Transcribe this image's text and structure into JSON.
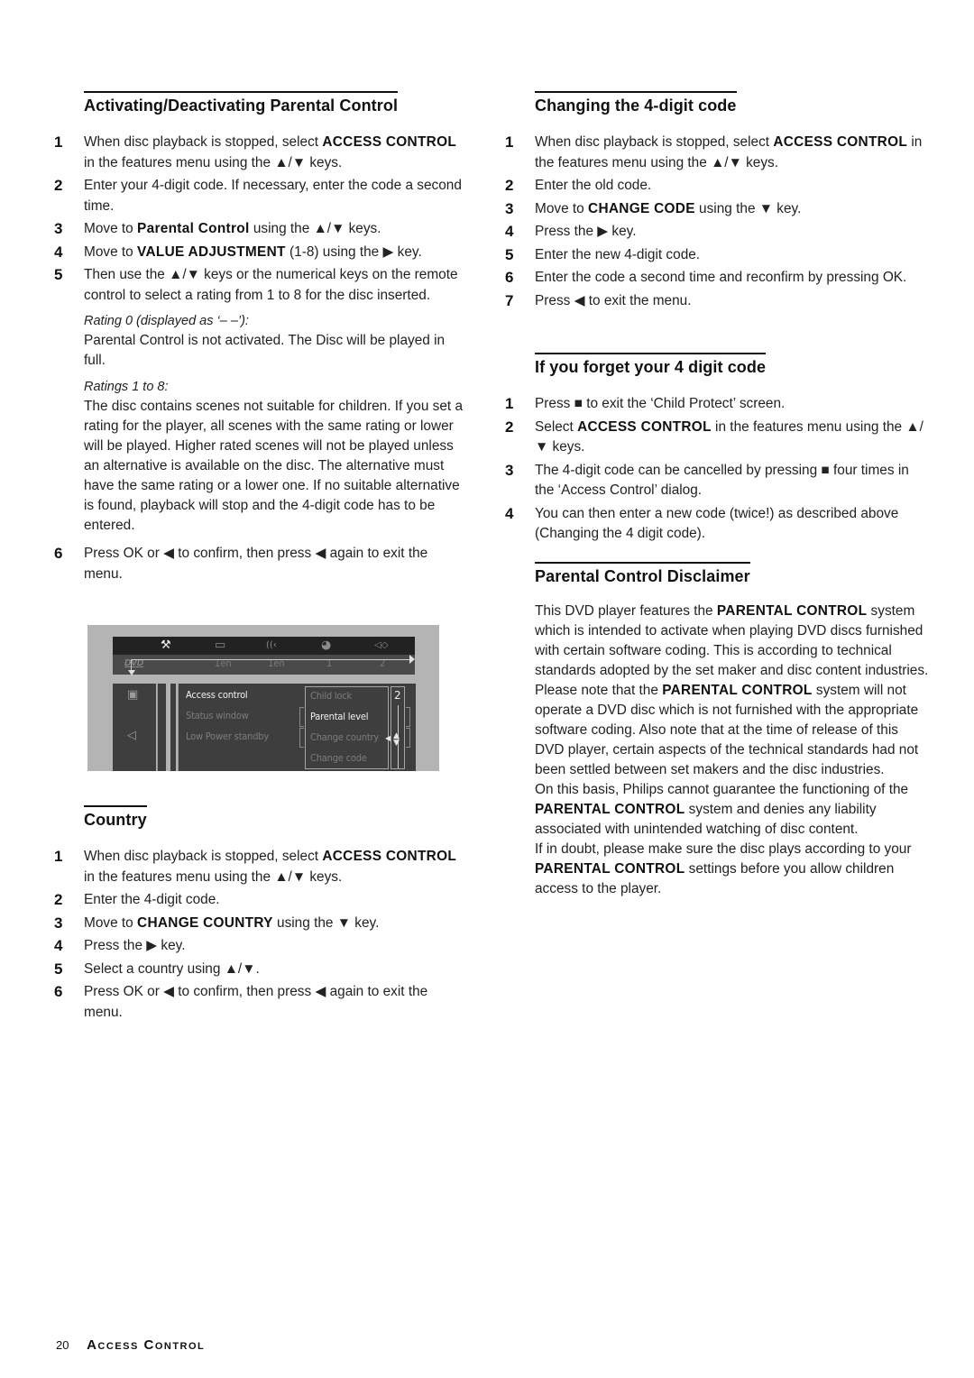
{
  "left": {
    "activating": {
      "title": "Activating/Deactivating Parental Control",
      "steps": [
        {
          "num": "1",
          "pre": "When disc playback is stopped, select ",
          "bold": "ACCESS CONTROL",
          "post": " in the features menu using the ▲/▼ keys."
        },
        {
          "num": "2",
          "pre": "Enter your 4-digit code. If necessary, enter the code a second time.",
          "bold": "",
          "post": ""
        },
        {
          "num": "3",
          "pre": "Move to ",
          "bold": "Parental Control",
          "post": " using the ▲/▼ keys."
        },
        {
          "num": "4",
          "pre": "Move to ",
          "bold": "VALUE ADJUSTMENT",
          "post": " (1-8) using the ▶ key."
        },
        {
          "num": "5",
          "pre": "Then use the ▲/▼ keys or the numerical keys on the remote control to select a rating from 1 to 8 for the disc inserted.",
          "bold": "",
          "post": ""
        }
      ],
      "rating0_head": "Rating 0 (displayed as ‘– –’):",
      "rating0_text": "Parental Control is not activated. The Disc will be played in full.",
      "ratings_head": "Ratings 1 to 8:",
      "ratings_text": "The disc contains scenes not suitable for children. If you set a rating for the player, all scenes with the same rating or lower will be played. Higher rated scenes will not be played unless an alternative is available on the disc. The alternative must have the same rating or a lower one. If no suitable alternative is found, playback will stop and the 4-digit code has to be entered.",
      "step6": {
        "num": "6",
        "text": "Press OK or ◀ to confirm, then press ◀ again to exit the menu."
      }
    },
    "osd": {
      "dvd_logo": "DVD",
      "top_icons": [
        "⚒",
        "▭",
        "((‹",
        "◕",
        "◁◇"
      ],
      "top_values": [
        "1en",
        "1en",
        "1",
        "2"
      ],
      "side_icons": [
        "▣",
        "◁"
      ],
      "menu_items": [
        "Access control",
        "Status window",
        "Low Power standby"
      ],
      "submenu_items": [
        "Child lock",
        "Parental level",
        "Change country",
        "Change code"
      ],
      "level_value": "2"
    },
    "country": {
      "title": "Country",
      "steps": [
        {
          "num": "1",
          "pre": "When disc playback is stopped, select ",
          "bold": "ACCESS CONTROL",
          "post": " in the features menu using the ▲/▼ keys."
        },
        {
          "num": "2",
          "pre": "Enter the 4-digit code.",
          "bold": "",
          "post": ""
        },
        {
          "num": "3",
          "pre": "Move to ",
          "bold": "CHANGE COUNTRY",
          "post": " using the ▼ key."
        },
        {
          "num": "4",
          "pre": "Press the ▶ key.",
          "bold": "",
          "post": ""
        },
        {
          "num": "5",
          "pre": "Select a country using ▲/▼.",
          "bold": "",
          "post": ""
        },
        {
          "num": "6",
          "pre": "Press OK or ◀ to confirm, then press ◀ again to exit the menu.",
          "bold": "",
          "post": ""
        }
      ]
    }
  },
  "right": {
    "changing": {
      "title": "Changing the 4-digit code",
      "steps": [
        {
          "num": "1",
          "pre": "When disc playback is stopped, select ",
          "bold": "ACCESS CONTROL",
          "post": " in the features menu using the ▲/▼ keys."
        },
        {
          "num": "2",
          "pre": "Enter the old code.",
          "bold": "",
          "post": ""
        },
        {
          "num": "3",
          "pre": "Move to ",
          "bold": "CHANGE CODE",
          "post": " using the ▼ key."
        },
        {
          "num": "4",
          "pre": "Press the ▶ key.",
          "bold": "",
          "post": ""
        },
        {
          "num": "5",
          "pre": "Enter the new 4-digit code.",
          "bold": "",
          "post": ""
        },
        {
          "num": "6",
          "pre": "Enter the code a second time and reconfirm by pressing OK.",
          "bold": "",
          "post": ""
        },
        {
          "num": "7",
          "pre": "Press ◀ to exit the menu.",
          "bold": "",
          "post": ""
        }
      ]
    },
    "forget": {
      "title": "If you forget your 4 digit code",
      "steps": [
        {
          "num": "1",
          "pre": "Press ■ to exit the ‘Child Protect’ screen.",
          "bold": "",
          "post": ""
        },
        {
          "num": "2",
          "pre": "Select ",
          "bold": "ACCESS CONTROL",
          "post": " in the features menu using the ▲/▼ keys."
        },
        {
          "num": "3",
          "pre": "The 4-digit code can be cancelled by pressing ■ four times in the ‘Access Control’ dialog.",
          "bold": "",
          "post": ""
        },
        {
          "num": "4",
          "pre": "You can then enter a new code (twice!) as described above (Changing the 4 digit code).",
          "bold": "",
          "post": ""
        }
      ]
    },
    "disclaimer": {
      "title": "Parental Control Disclaimer",
      "paragraphs": [
        {
          "pre": "This DVD player features the ",
          "bold": "PARENTAL CONTROL",
          "post": " system which is intended to activate when playing DVD discs furnished with certain software coding. This is according to technical standards adopted by the set maker and disc content industries."
        },
        {
          "pre": "Please note that the ",
          "bold": "PARENTAL CONTROL",
          "post": " system will not operate a DVD disc which is not furnished with the appropriate software coding. Also note that at the time of release of this DVD player, certain aspects of the technical standards had not been settled between set makers and the disc industries."
        },
        {
          "pre": "On this basis, Philips cannot guarantee the functioning of the ",
          "bold": "PARENTAL CONTROL",
          "post": " system and denies any liability associated with unintended watching of disc content."
        },
        {
          "pre": "If in doubt, please make sure the disc plays according to your ",
          "bold": "PARENTAL CONTROL",
          "post": " settings before you allow children access to the player."
        }
      ]
    }
  },
  "footer": {
    "page_number": "20",
    "section_title": "Access Control"
  }
}
